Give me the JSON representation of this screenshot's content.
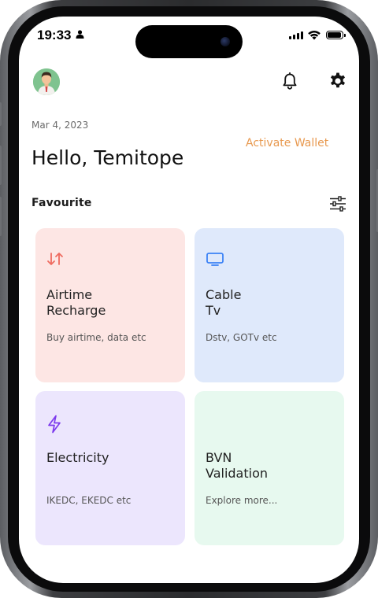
{
  "status_bar": {
    "time": "19:33"
  },
  "header": {
    "avatar_icon": "user-avatar",
    "notification_icon": "bell-icon",
    "settings_icon": "gear-icon"
  },
  "greeting": {
    "date": "Mar 4, 2023",
    "hello": "Hello, Temitope",
    "activate_wallet": "Activate Wallet"
  },
  "favourites": {
    "label": "Favourite",
    "filter_icon": "sliders-icon",
    "cards": [
      {
        "title": "Airtime\nRecharge",
        "subtitle": "Buy airtime, data etc",
        "icon": "swap-arrows-icon",
        "color": "#fde6e4",
        "icon_color": "#ef6a5f"
      },
      {
        "title": "Cable\nTv",
        "subtitle": "Dstv, GOTv etc",
        "icon": "tv-icon",
        "color": "#dfe9fb",
        "icon_color": "#3b82f6"
      },
      {
        "title": "Electricity",
        "subtitle": "IKEDC, EKEDC etc",
        "icon": "lightning-icon",
        "color": "#ece6fd",
        "icon_color": "#7c3aed"
      },
      {
        "title": "BVN\nValidation",
        "subtitle": "Explore more...",
        "icon": "id-icon",
        "color": "#e7f9ef",
        "icon_color": "#22a06b"
      }
    ]
  },
  "colors": {
    "accent": "#e8994f",
    "text_primary": "#111111"
  }
}
